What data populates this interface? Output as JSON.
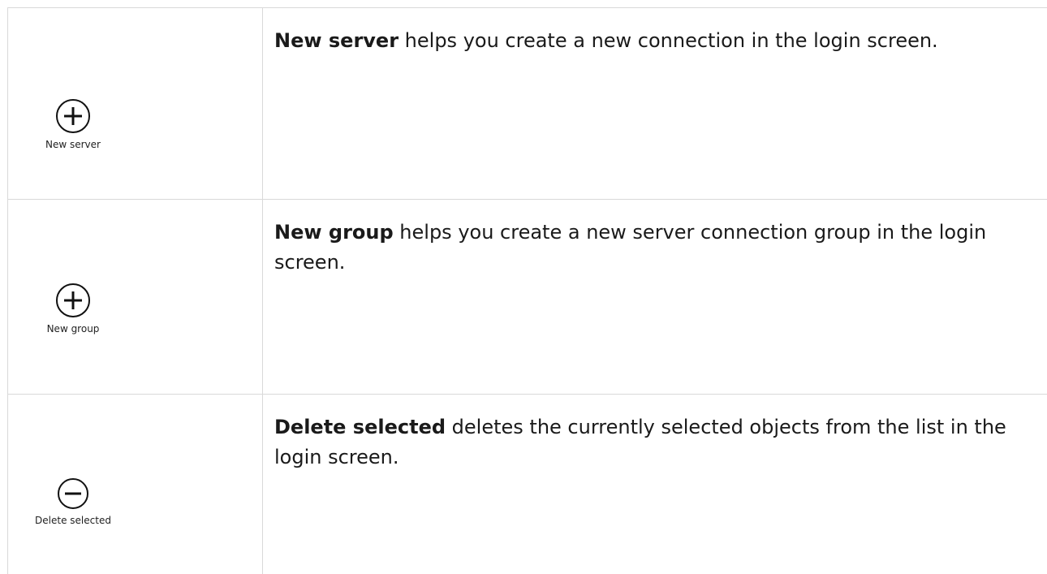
{
  "rows": [
    {
      "icon": "plus-circle-icon",
      "label": "New server",
      "title": "New server",
      "description": " helps you create a new connection in the login screen."
    },
    {
      "icon": "plus-circle-icon",
      "label": "New group",
      "title": "New group",
      "description": " helps you create a new server connection group in the login screen."
    },
    {
      "icon": "minus-circle-icon",
      "label": "Delete selected",
      "title": "Delete selected",
      "description": " deletes the currently selected objects from the list in the login screen."
    }
  ]
}
